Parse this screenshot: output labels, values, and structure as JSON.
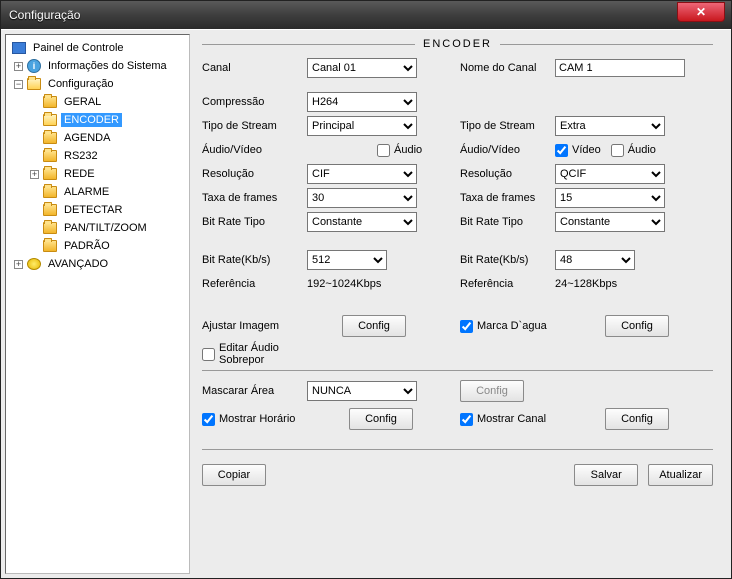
{
  "window": {
    "title": "Configuração"
  },
  "tree": {
    "root": "Painel de Controle",
    "info": "Informações do Sistema",
    "config": "Configuração",
    "advanced": "AVANÇADO",
    "items": [
      "GERAL",
      "ENCODER",
      "AGENDA",
      "RS232",
      "REDE",
      "ALARME",
      "DETECTAR",
      "PAN/TILT/ZOOM",
      "PADRÃO"
    ],
    "selectedIndex": 1
  },
  "encoder": {
    "title": "ENCODER",
    "labels": {
      "canal": "Canal",
      "nomeCanal": "Nome do Canal",
      "compressao": "Compressão",
      "tipoStream": "Tipo de Stream",
      "audioVideo": "Áudio/Vídeo",
      "audio": "Áudio",
      "video": "Vídeo",
      "resolucao": "Resolução",
      "taxaFrames": "Taxa de frames",
      "bitrateTipo": "Bit Rate Tipo",
      "bitrateKbs": "Bit Rate(Kb/s)",
      "referencia": "Referência",
      "ajustarImagem": "Ajustar Imagem",
      "config": "Config",
      "marcaDagua": "Marca D`agua",
      "editarAudio": "Editar Áudio Sobrepor",
      "mascararArea": "Mascarar Área",
      "mostrarHorario": "Mostrar Horário",
      "mostrarCanal": "Mostrar Canal",
      "copiar": "Copiar",
      "salvar": "Salvar",
      "atualizar": "Atualizar"
    },
    "values": {
      "canal": "Canal 01",
      "nomeCanal": "CAM 1",
      "compressao": "H264",
      "tipoStreamMain": "Principal",
      "tipoStreamExtra": "Extra",
      "audioMain": false,
      "videoExtra": true,
      "audioExtra": false,
      "resMain": "CIF",
      "resExtra": "QCIF",
      "fpsMain": "30",
      "fpsExtra": "15",
      "brtMain": "Constante",
      "brtExtra": "Constante",
      "brMain": "512",
      "brExtra": "48",
      "refMain": "192~1024Kbps",
      "refExtra": "24~128Kbps",
      "marcaDagua": true,
      "editarAudio": false,
      "mascarar": "NUNCA",
      "mostrarHorario": true,
      "mostrarCanal": true
    }
  }
}
